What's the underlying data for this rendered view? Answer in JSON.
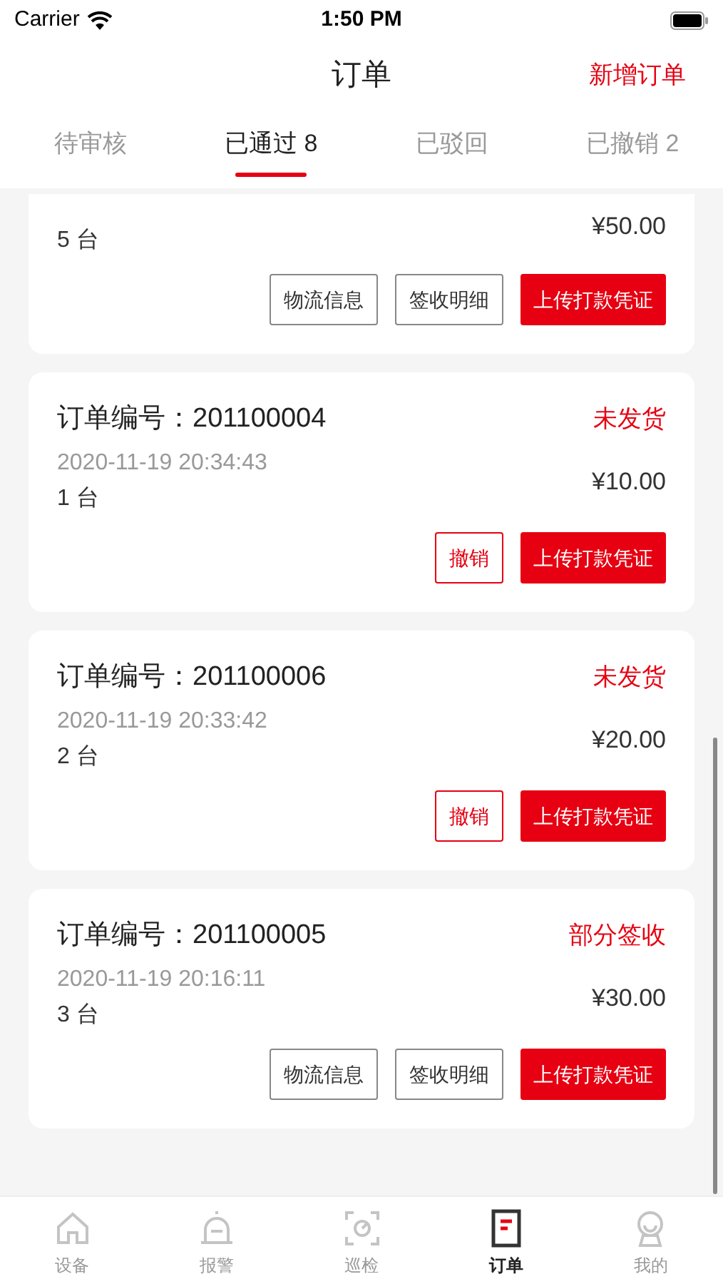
{
  "status_bar": {
    "carrier": "Carrier",
    "time": "1:50 PM"
  },
  "header": {
    "title": "订单",
    "action": "新增订单"
  },
  "tabs": [
    {
      "label": "待审核",
      "selected": false
    },
    {
      "label": "已通过 8",
      "selected": true
    },
    {
      "label": "已驳回",
      "selected": false
    },
    {
      "label": "已撤销 2",
      "selected": false
    }
  ],
  "orders": [
    {
      "quantity": "5 台",
      "price": "¥50.00",
      "buttons": [
        {
          "label": "物流信息",
          "kind": "outline"
        },
        {
          "label": "签收明细",
          "kind": "outline"
        },
        {
          "label": "上传打款凭证",
          "kind": "primary"
        }
      ]
    },
    {
      "order_no": "订单编号：201100004",
      "status": "未发货",
      "date": "2020-11-19 20:34:43",
      "quantity": "1 台",
      "price": "¥10.00",
      "buttons": [
        {
          "label": "撤销",
          "kind": "danger"
        },
        {
          "label": "上传打款凭证",
          "kind": "primary"
        }
      ]
    },
    {
      "order_no": "订单编号：201100006",
      "status": "未发货",
      "date": "2020-11-19 20:33:42",
      "quantity": "2 台",
      "price": "¥20.00",
      "buttons": [
        {
          "label": "撤销",
          "kind": "danger"
        },
        {
          "label": "上传打款凭证",
          "kind": "primary"
        }
      ]
    },
    {
      "order_no": "订单编号：201100005",
      "status": "部分签收",
      "date": "2020-11-19 20:16:11",
      "quantity": "3 台",
      "price": "¥30.00",
      "buttons": [
        {
          "label": "物流信息",
          "kind": "outline"
        },
        {
          "label": "签收明细",
          "kind": "outline"
        },
        {
          "label": "上传打款凭证",
          "kind": "primary"
        }
      ]
    }
  ],
  "tab_bar": [
    {
      "label": "设备",
      "kind": "home",
      "selected": false
    },
    {
      "label": "报警",
      "kind": "alarm",
      "selected": false
    },
    {
      "label": "巡检",
      "kind": "scan",
      "selected": false
    },
    {
      "label": "订单",
      "kind": "order",
      "selected": true
    },
    {
      "label": "我的",
      "kind": "user",
      "selected": false
    }
  ]
}
